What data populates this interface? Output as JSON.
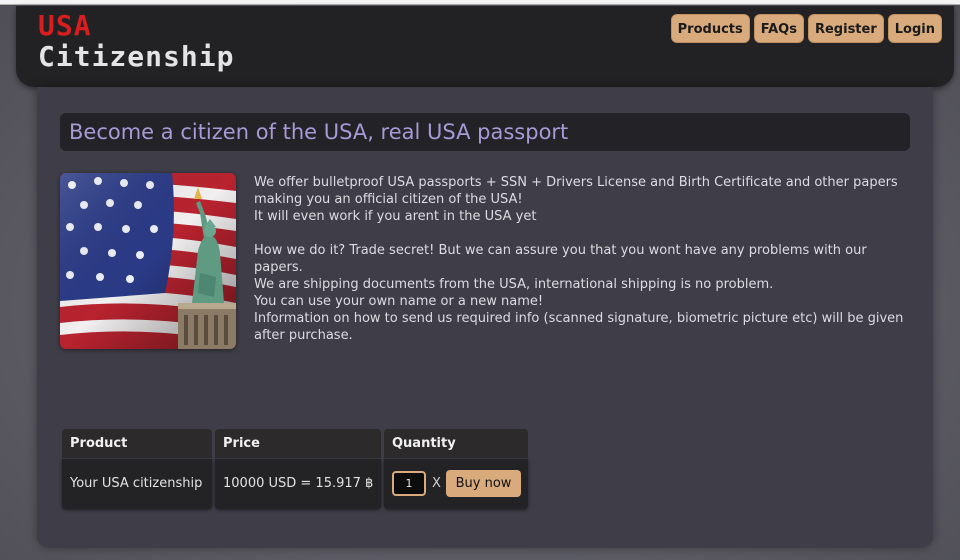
{
  "logo": {
    "line1": "USA",
    "line2": "Citizenship"
  },
  "nav": [
    {
      "label": "Products"
    },
    {
      "label": "FAQs"
    },
    {
      "label": "Register"
    },
    {
      "label": "Login"
    }
  ],
  "page": {
    "title": "Become a citizen of the USA, real USA passport",
    "description": [
      "We offer bulletproof USA passports + SSN + Drivers License and Birth Certificate and other papers making you an official citizen of the USA!",
      "It will even work if you arent in the USA yet",
      "",
      "How we do it? Trade secret! But we can assure you that you wont have any problems with our papers.",
      "We are shipping documents from the USA, international shipping is no problem.",
      "You can use your own name or a new name!",
      "Information on how to send us required info (scanned signature, biometric picture etc) will be given after purchase."
    ]
  },
  "table": {
    "headers": [
      "Product",
      "Price",
      "Quantity"
    ],
    "row": {
      "product": "Your USA citizenship",
      "price": "10000 USD = 15.917 ฿",
      "quantity": "1",
      "times": "X",
      "buy_label": "Buy now"
    }
  },
  "colors": {
    "accent": "#d8aa7c",
    "logo_red": "#d81e1e",
    "title": "#a79ad6",
    "panel": "#3f3d47",
    "header": "#222124"
  },
  "icons": {
    "hero": "usa-flag-statue-of-liberty-image"
  }
}
